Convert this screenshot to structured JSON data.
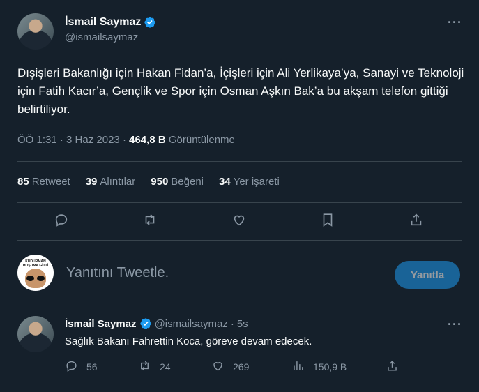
{
  "tweet": {
    "display_name": "İsmail Saymaz",
    "handle": "@ismailsaymaz",
    "text": "Dışişleri Bakanlığı için Hakan Fidan’a, İçişleri için Ali Yerlikaya’ya, Sanayi ve Teknoloji için Fatih Kacır’a, Gençlik ve Spor için Osman Aşkın Bak’a bu akşam telefon gittiği belirtiliyor.",
    "time": "ÖÖ 1:31",
    "separator": "·",
    "date": "3 Haz 2023",
    "views_count": "464,8 B",
    "views_label": "Görüntülenme",
    "stats": {
      "retweets_count": "85",
      "retweets_label": "Retweet",
      "quotes_count": "39",
      "quotes_label": "Alıntılar",
      "likes_count": "950",
      "likes_label": "Beğeni",
      "bookmarks_count": "34",
      "bookmarks_label": "Yer işareti"
    }
  },
  "composer": {
    "placeholder": "Yanıtını Tweetle.",
    "reply_button": "Yanıtla",
    "avatar_text_line1": "KUDURMAN",
    "avatar_text_line2": "HOŞUMA GİTTİ"
  },
  "reply_tweet": {
    "display_name": "İsmail Saymaz",
    "handle": "@ismailsaymaz",
    "separator": "·",
    "time": "5s",
    "text": "Sağlık Bakanı Fahrettin Koca, göreve devam edecek.",
    "replies": "56",
    "retweets": "24",
    "likes": "269",
    "views": "150,9 B"
  },
  "colors": {
    "background": "#15202b",
    "accent": "#1d9bf0",
    "secondary_text": "#8b98a5",
    "divider": "#38444d"
  },
  "icons": [
    "verified-badge-icon",
    "more-icon",
    "reply-icon",
    "retweet-icon",
    "like-icon",
    "bookmark-icon",
    "share-icon",
    "views-icon"
  ]
}
